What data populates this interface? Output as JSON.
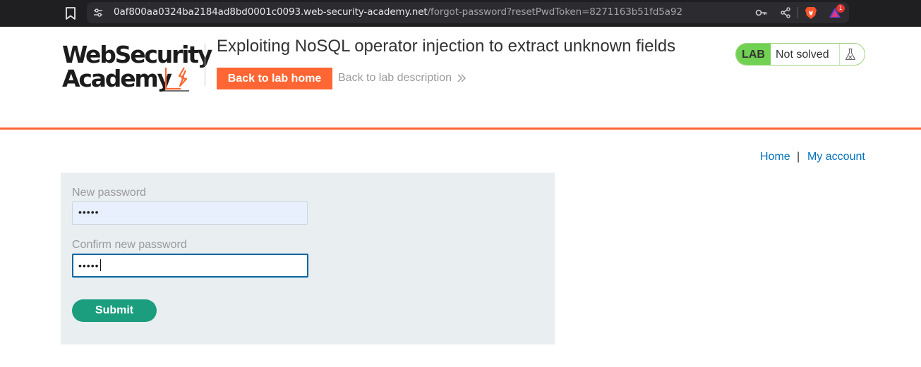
{
  "browser": {
    "url_host": "0af800aa0324ba2184ad8bd0001c0093.web-security-academy.net",
    "url_path": "/forgot-password?resetPwdToken=8271163b51fd5a92",
    "rewards_count": "1",
    "icons": [
      "bookmark-icon",
      "site-info-icon",
      "key-icon",
      "share-icon",
      "brave-icon",
      "rewards-icon"
    ]
  },
  "header": {
    "logo_line1": "WebSecurity",
    "logo_line2": "Academy",
    "lab_title": "Exploiting NoSQL operator injection to extract unknown fields",
    "back_home_label": "Back to lab home",
    "back_description_label": "Back to lab description",
    "lab_tag": "LAB",
    "lab_status": "Not solved",
    "accent_color": "#ff6633"
  },
  "nav": {
    "home": "Home",
    "separator": "|",
    "account": "My account"
  },
  "form": {
    "new_password_label": "New password",
    "new_password_value": "•••••",
    "confirm_password_label": "Confirm new password",
    "confirm_password_value": "•••••",
    "submit_label": "Submit"
  }
}
